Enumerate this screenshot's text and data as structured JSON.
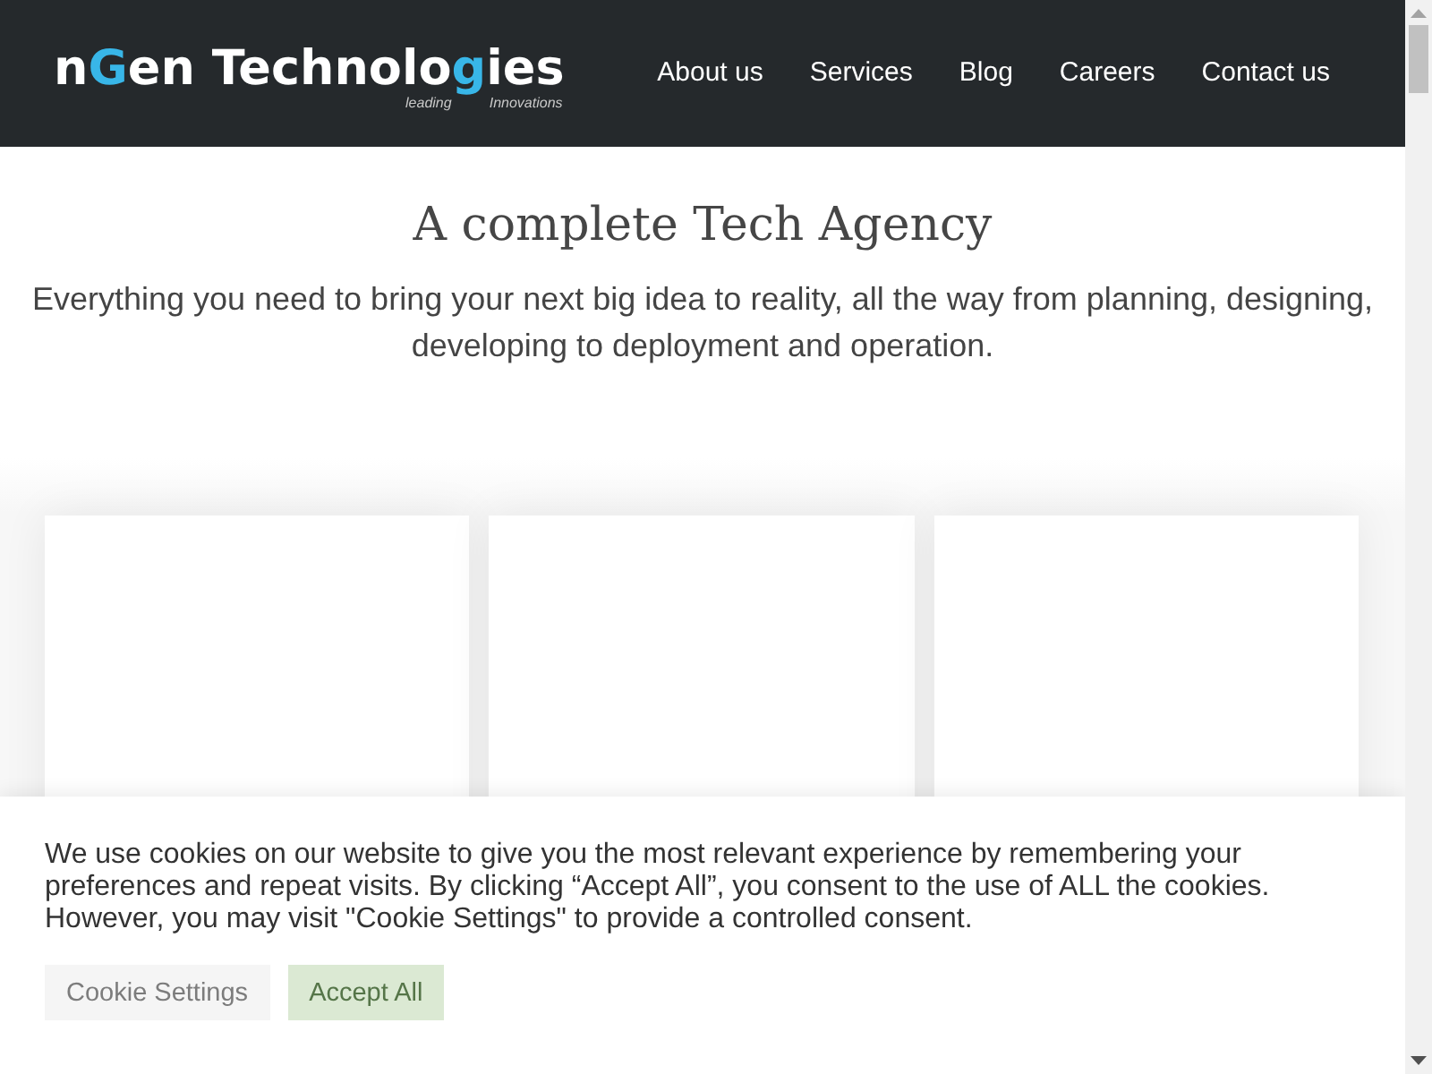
{
  "header": {
    "logo": {
      "parts": [
        {
          "text": "n",
          "accent": false
        },
        {
          "text": "G",
          "accent": true
        },
        {
          "text": "en Technolo",
          "accent": false
        },
        {
          "text": "g",
          "accent": true
        },
        {
          "text": "ies",
          "accent": false
        }
      ],
      "tagline": [
        "leading",
        "Innovations"
      ]
    },
    "nav": [
      "About us",
      "Services",
      "Blog",
      "Careers",
      "Contact us"
    ]
  },
  "hero": {
    "title": "A complete Tech Agency",
    "subtitle": "Everything you need to bring your next big idea to reality, all the way from planning, designing, developing to deployment and operation."
  },
  "cookie_banner": {
    "message": "We use cookies on our website to give you the most relevant experience by remembering your preferences and repeat visits. By clicking “Accept All”, you consent to the use of ALL the cookies. However, you may visit \"Cookie Settings\" to provide a controlled consent.",
    "buttons": [
      {
        "label": "Cookie Settings",
        "kind": "secondary"
      },
      {
        "label": "Accept All",
        "kind": "primary"
      }
    ]
  }
}
